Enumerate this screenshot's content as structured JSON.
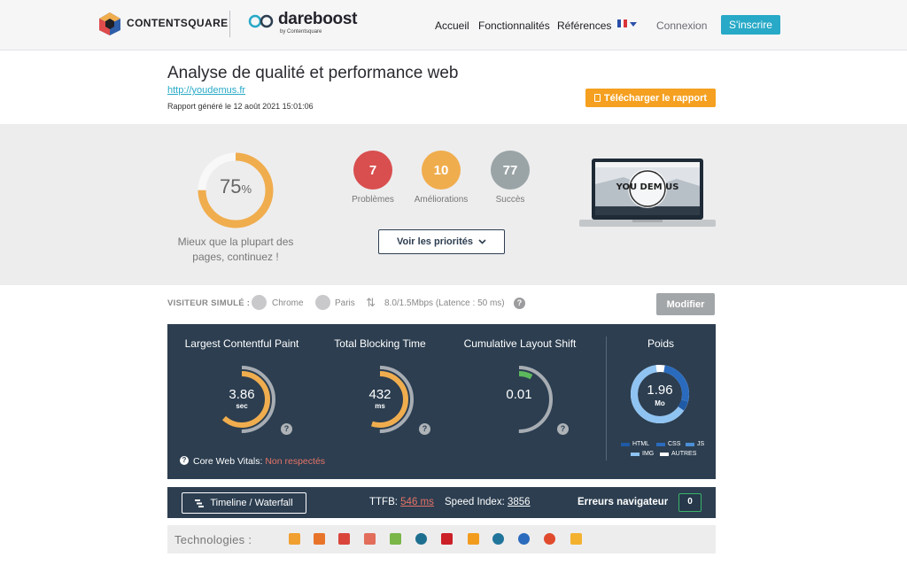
{
  "header": {
    "brand1": "CONTENTSQUARE",
    "brand2": "dareboost",
    "brand2_sub": "by Contentsquare",
    "nav": [
      "Accueil",
      "Fonctionnalités",
      "Références"
    ],
    "login": "Connexion",
    "signup": "S'inscrire",
    "language_icon": "french-flag-icon"
  },
  "report": {
    "title": "Analyse de qualité et performance web",
    "url": "http://youdemus.fr",
    "generated": "Rapport généré le 12 août 2021 15:01:06",
    "download_label": "Télécharger le rapport"
  },
  "summary": {
    "score": 75,
    "score_unit": "%",
    "score_message_line1": "Mieux que la plupart des",
    "score_message_line2": "pages, continuez !",
    "problems": {
      "count": "7",
      "label": "Problèmes"
    },
    "improvements": {
      "count": "10",
      "label": "Améliorations"
    },
    "successes": {
      "count": "77",
      "label": "Succès"
    },
    "priorities_label": "Voir les priorités",
    "screenshot_caption": "YOU DEM US"
  },
  "visitor": {
    "label": "VISITEUR SIMULÉ :",
    "browser": "Chrome",
    "city": "Paris",
    "connection": "8.0/1.5Mbps (Latence : 50 ms)",
    "modify_label": "Modifier"
  },
  "metrics": {
    "lcp": {
      "title": "Largest Contentful Paint",
      "value": "3.86",
      "unit": "sec",
      "fill": 0.62
    },
    "tbt": {
      "title": "Total Blocking Time",
      "value": "432",
      "unit": "ms",
      "fill": 0.55
    },
    "cls": {
      "title": "Cumulative Layout Shift",
      "value": "0.01",
      "unit": "",
      "fill": 0.08
    },
    "weight": {
      "title": "Poids",
      "value": "1.96",
      "unit": "Mo",
      "legend": [
        "HTML",
        "CSS",
        "JS",
        "IMG",
        "AUTRES"
      ]
    },
    "cwv_label": "Core Web Vitals:",
    "cwv_status": "Non respectés"
  },
  "bottom": {
    "timeline_label": "Timeline / Waterfall",
    "ttfb_label": "TTFB:",
    "ttfb_value": "546 ms",
    "speed_index_label": "Speed Index:",
    "speed_index_value": "3856",
    "errors_label": "Erreurs navigateur",
    "errors_count": "0"
  },
  "technologies": {
    "label": "Technologies :",
    "icons": [
      "jquery-icon",
      "cms-icon",
      "font-icon",
      "analytics-icon",
      "maps-icon",
      "tracking-icon",
      "pinterest-icon",
      "yoast-icon",
      "wordpress-icon",
      "cdn-icon",
      "cloud-icon",
      "php-icon"
    ]
  },
  "colors": {
    "accent": "#27a9c7",
    "orange": "#f0ad4e",
    "red": "#d94e4e",
    "panel": "#2c3e50"
  }
}
